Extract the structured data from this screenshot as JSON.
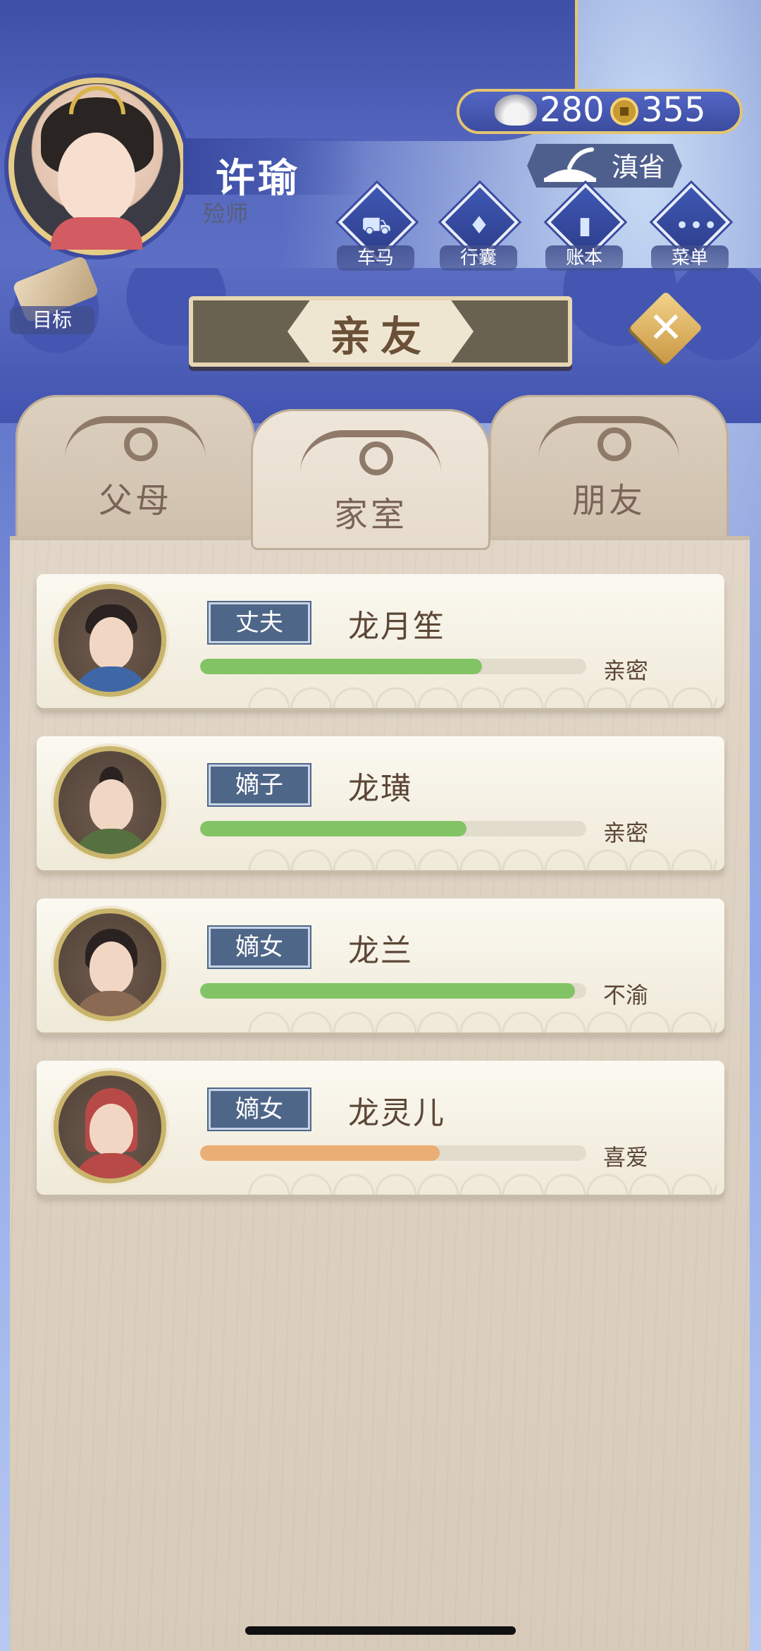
{
  "player": {
    "name": "许瑜",
    "title": "殓师"
  },
  "currency": {
    "silver": "280",
    "coins": "355"
  },
  "region": {
    "label": "滇省"
  },
  "menu": [
    {
      "label": "车马",
      "icon": "carriage-icon"
    },
    {
      "label": "行囊",
      "icon": "bag-icon"
    },
    {
      "label": "账本",
      "icon": "ledger-icon"
    },
    {
      "label": "菜单",
      "icon": "more-icon"
    }
  ],
  "goal": {
    "label": "目标"
  },
  "panel": {
    "title": "亲友"
  },
  "tabs": [
    {
      "label": "父母",
      "active": false
    },
    {
      "label": "家室",
      "active": true
    },
    {
      "label": "朋友",
      "active": false
    }
  ],
  "members": [
    {
      "role": "丈夫",
      "name": "龙月笙",
      "relation": "亲密",
      "affinity": 0.73,
      "bar_color": "#82c465"
    },
    {
      "role": "嫡子",
      "name": "龙璜",
      "relation": "亲密",
      "affinity": 0.69,
      "bar_color": "#82c465"
    },
    {
      "role": "嫡女",
      "name": "龙兰",
      "relation": "不渝",
      "affinity": 0.97,
      "bar_color": "#82c465"
    },
    {
      "role": "嫡女",
      "name": "龙灵儿",
      "relation": "喜爱",
      "affinity": 0.62,
      "bar_color": "#ebae74"
    }
  ]
}
